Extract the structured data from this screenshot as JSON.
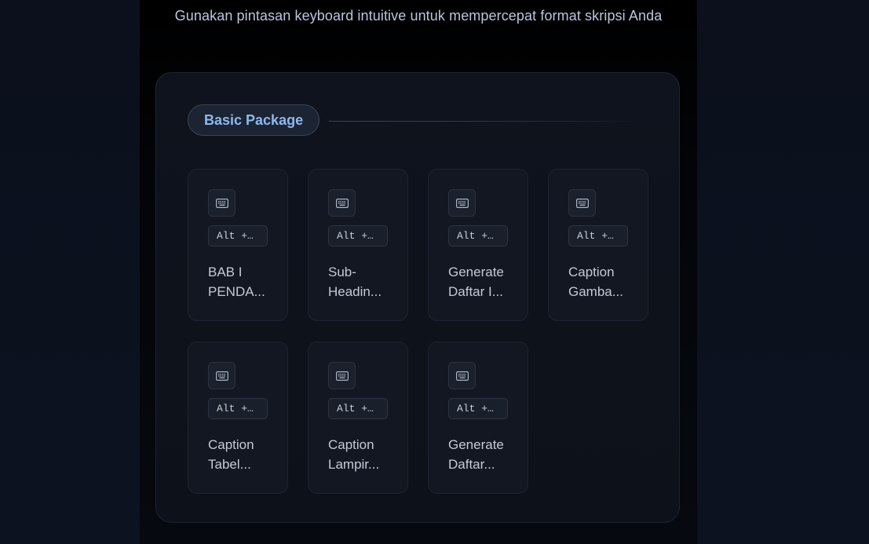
{
  "header": {
    "subtitle": "Gunakan pintasan keyboard intuitive untuk mempercepat format skripsi Anda"
  },
  "package": {
    "label": "Basic Package"
  },
  "shortcuts": [
    {
      "key": "Alt +…",
      "title_line1": "BAB I",
      "title_line2": "PENDA...",
      "icon": "keyboard-icon"
    },
    {
      "key": "Alt +…",
      "title_line1": "Sub-",
      "title_line2": "Headin...",
      "icon": "keyboard-icon"
    },
    {
      "key": "Alt +…",
      "title_line1": "Generate",
      "title_line2": "Daftar I...",
      "icon": "keyboard-icon"
    },
    {
      "key": "Alt +…",
      "title_line1": "Caption",
      "title_line2": "Gamba...",
      "icon": "keyboard-icon"
    },
    {
      "key": "Alt +…",
      "title_line1": "Caption",
      "title_line2": "Tabel...",
      "icon": "keyboard-icon"
    },
    {
      "key": "Alt +…",
      "title_line1": "Caption",
      "title_line2": "Lampir...",
      "icon": "keyboard-icon"
    },
    {
      "key": "Alt +…",
      "title_line1": "Generate",
      "title_line2": "Daftar...",
      "icon": "keyboard-icon"
    }
  ],
  "colors": {
    "accent": "#8db8ee",
    "text": "#c4cad6",
    "card_bg": "#121722"
  }
}
